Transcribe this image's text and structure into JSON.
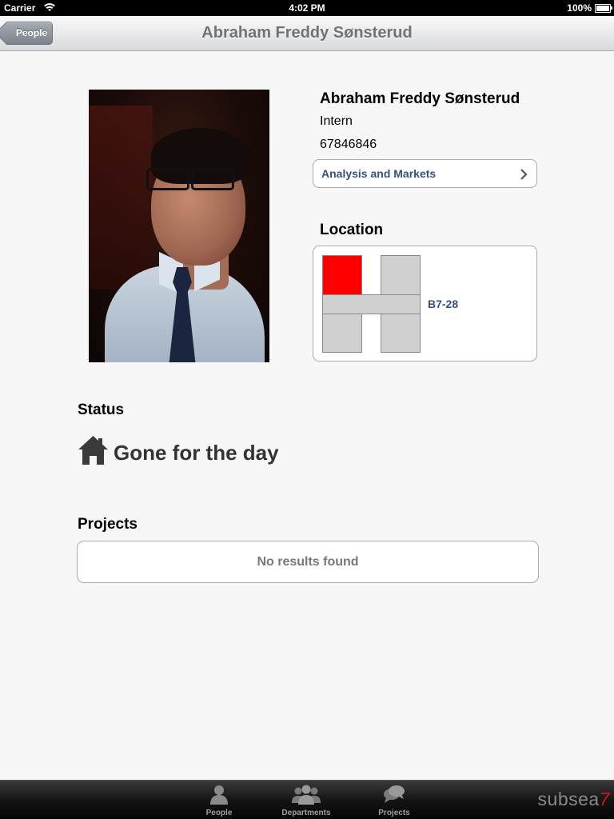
{
  "status_bar": {
    "carrier": "Carrier",
    "time": "4:02 PM",
    "battery": "100%"
  },
  "nav": {
    "back_label": "People",
    "title": "Abraham Freddy Sønsterud"
  },
  "profile": {
    "name": "Abraham Freddy Sønsterud",
    "title": "Intern",
    "phone": "67846846",
    "department": "Analysis and Markets"
  },
  "location": {
    "heading": "Location",
    "room": "B7-28",
    "highlight_color": "#ff0000"
  },
  "status": {
    "heading": "Status",
    "icon": "house-icon",
    "text": "Gone for the day"
  },
  "projects": {
    "heading": "Projects",
    "empty_text": "No results found"
  },
  "tabs": [
    {
      "label": "People",
      "icon": "person-icon"
    },
    {
      "label": "Departments",
      "icon": "group-icon"
    },
    {
      "label": "Projects",
      "icon": "speech-bubbles-icon"
    }
  ],
  "brand": {
    "name": "subsea",
    "number": "7"
  }
}
